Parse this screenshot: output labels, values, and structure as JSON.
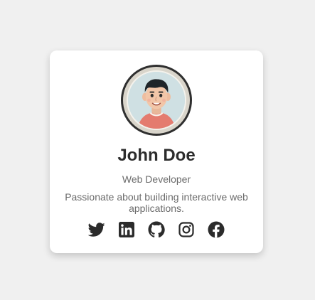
{
  "profile": {
    "name": "John Doe",
    "title": "Web Developer",
    "bio": "Passionate about building interactive web applications."
  },
  "social": [
    {
      "name": "twitter-icon"
    },
    {
      "name": "linkedin-icon"
    },
    {
      "name": "github-icon"
    },
    {
      "name": "instagram-icon"
    },
    {
      "name": "facebook-icon"
    }
  ],
  "colors": {
    "background": "#f0f0f0",
    "card": "#ffffff",
    "text_primary": "#2c2c2c",
    "text_secondary": "#6b6b6b",
    "icon": "#2b2b2b"
  }
}
